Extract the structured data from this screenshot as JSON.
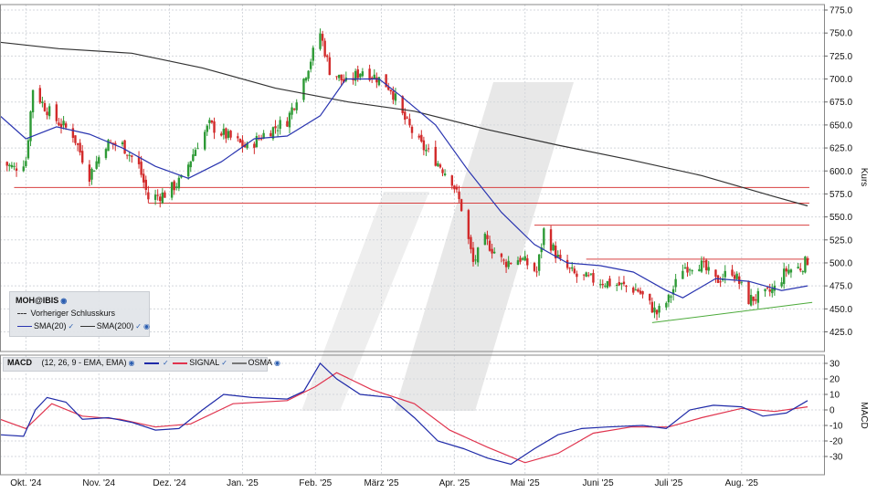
{
  "chart_data": [
    {
      "type": "candlestick",
      "symbol": "MOH@IBIS",
      "ylabel": "Kurs",
      "ylim": [
        425,
        775
      ],
      "yticks": [
        "775.0",
        "750.0",
        "725.0",
        "700.0",
        "675.0",
        "650.0",
        "625.0",
        "600.0",
        "575.0",
        "550.0",
        "525.0",
        "500.0",
        "475.0",
        "450.0",
        "425.0"
      ],
      "xticks": [
        "Okt. '24",
        "Nov. '24",
        "Dez. '24",
        "Jan. '25",
        "Feb. '25",
        "März '25",
        "Apr. '25",
        "Mai '25",
        "Juni '25",
        "Juli '25",
        "Aug. '25"
      ],
      "legend": {
        "symbol": "MOH@IBIS",
        "prev_close": "Vorheriger Schlusskurs",
        "sma20": "SMA(20)",
        "sma200": "SMA(200)"
      },
      "price_path": [
        [
          "2024-09-20",
          610
        ],
        [
          "2024-09-26",
          603
        ],
        [
          "2024-10-01",
          612
        ],
        [
          "2024-10-04",
          690
        ],
        [
          "2024-10-09",
          670
        ],
        [
          "2024-10-14",
          655
        ],
        [
          "2024-10-21",
          640
        ],
        [
          "2024-10-28",
          595
        ],
        [
          "2024-11-04",
          630
        ],
        [
          "2024-11-11",
          628
        ],
        [
          "2024-11-18",
          605
        ],
        [
          "2024-11-22",
          570
        ],
        [
          "2024-11-29",
          575
        ],
        [
          "2024-12-06",
          590
        ],
        [
          "2024-12-13",
          630
        ],
        [
          "2024-12-18",
          650
        ],
        [
          "2024-12-24",
          640
        ],
        [
          "2025-01-03",
          625
        ],
        [
          "2025-01-10",
          640
        ],
        [
          "2025-01-20",
          655
        ],
        [
          "2025-01-27",
          700
        ],
        [
          "2025-02-03",
          750
        ],
        [
          "2025-02-07",
          710
        ],
        [
          "2025-02-14",
          695
        ],
        [
          "2025-02-21",
          710
        ],
        [
          "2025-02-28",
          700
        ],
        [
          "2025-03-05",
          690
        ],
        [
          "2025-03-10",
          660
        ],
        [
          "2025-03-17",
          630
        ],
        [
          "2025-03-24",
          612
        ],
        [
          "2025-03-31",
          590
        ],
        [
          "2025-04-04",
          560
        ],
        [
          "2025-04-09",
          500
        ],
        [
          "2025-04-14",
          525
        ],
        [
          "2025-04-22",
          500
        ],
        [
          "2025-04-29",
          505
        ],
        [
          "2025-05-06",
          490
        ],
        [
          "2025-05-09",
          535
        ],
        [
          "2025-05-16",
          500
        ],
        [
          "2025-05-23",
          485
        ],
        [
          "2025-06-02",
          480
        ],
        [
          "2025-06-10",
          476
        ],
        [
          "2025-06-18",
          470
        ],
        [
          "2025-06-26",
          445
        ],
        [
          "2025-07-01",
          460
        ],
        [
          "2025-07-07",
          495
        ],
        [
          "2025-07-14",
          500
        ],
        [
          "2025-07-21",
          480
        ],
        [
          "2025-07-28",
          492
        ],
        [
          "2025-08-04",
          460
        ],
        [
          "2025-08-11",
          465
        ],
        [
          "2025-08-15",
          472
        ],
        [
          "2025-08-20",
          492
        ],
        [
          "2025-08-26",
          495
        ],
        [
          "2025-08-29",
          503
        ]
      ],
      "sma20_path": [
        [
          "2024-09-20",
          660
        ],
        [
          "2024-10-01",
          635
        ],
        [
          "2024-10-14",
          648
        ],
        [
          "2024-10-28",
          640
        ],
        [
          "2024-11-11",
          625
        ],
        [
          "2024-11-25",
          605
        ],
        [
          "2024-12-09",
          592
        ],
        [
          "2024-12-23",
          610
        ],
        [
          "2025-01-06",
          635
        ],
        [
          "2025-01-20",
          638
        ],
        [
          "2025-02-03",
          660
        ],
        [
          "2025-02-14",
          700
        ],
        [
          "2025-02-28",
          700
        ],
        [
          "2025-03-10",
          680
        ],
        [
          "2025-03-24",
          650
        ],
        [
          "2025-04-07",
          600
        ],
        [
          "2025-04-21",
          555
        ],
        [
          "2025-05-05",
          520
        ],
        [
          "2025-05-19",
          500
        ],
        [
          "2025-06-02",
          497
        ],
        [
          "2025-06-16",
          490
        ],
        [
          "2025-06-30",
          470
        ],
        [
          "2025-07-07",
          462
        ],
        [
          "2025-07-21",
          483
        ],
        [
          "2025-08-04",
          480
        ],
        [
          "2025-08-18",
          470
        ],
        [
          "2025-08-29",
          475
        ]
      ],
      "sma200_path": [
        [
          "2024-09-20",
          740
        ],
        [
          "2024-10-15",
          733
        ],
        [
          "2024-11-15",
          728
        ],
        [
          "2024-12-15",
          712
        ],
        [
          "2025-01-15",
          690
        ],
        [
          "2025-02-15",
          675
        ],
        [
          "2025-03-15",
          665
        ],
        [
          "2025-04-15",
          645
        ],
        [
          "2025-05-15",
          628
        ],
        [
          "2025-06-15",
          612
        ],
        [
          "2025-07-15",
          595
        ],
        [
          "2025-08-15",
          572
        ],
        [
          "2025-08-29",
          562
        ]
      ],
      "horizontal_lines": [
        {
          "from": "2024-09-26",
          "to": "2025-08-29",
          "value": 582,
          "color": "#d84040"
        },
        {
          "from": "2024-11-22",
          "to": "2025-08-29",
          "value": 565,
          "color": "#d84040"
        },
        {
          "from": "2025-05-05",
          "to": "2025-08-29",
          "value": 541,
          "color": "#d84040"
        },
        {
          "from": "2025-05-27",
          "to": "2025-08-29",
          "value": 504,
          "color": "#d84040"
        }
      ],
      "trendline": {
        "from": [
          "2025-06-24",
          435
        ],
        "to": [
          "2025-08-31",
          457
        ],
        "color": "#4caa3a"
      },
      "colors": {
        "up": "#2e9a36",
        "down": "#d22a2a",
        "sma20": "#2a35b0",
        "sma200": "#333333",
        "grid": "#d4d7dc"
      }
    },
    {
      "type": "line",
      "title": "MACD",
      "params": "(12, 26, 9 - EMA, EMA)",
      "ylabel": "MACD",
      "ylim": [
        -35,
        32
      ],
      "yticks": [
        "30",
        "20",
        "10",
        "0",
        "-10",
        "-20",
        "-30"
      ],
      "legend": {
        "macd": "",
        "signal": "SIGNAL",
        "osma": "OSMA"
      },
      "macd_path": [
        [
          "2024-09-20",
          -16
        ],
        [
          "2024-09-30",
          -17
        ],
        [
          "2024-10-05",
          0
        ],
        [
          "2024-10-10",
          8
        ],
        [
          "2024-10-18",
          5
        ],
        [
          "2024-10-25",
          -6
        ],
        [
          "2024-11-05",
          -5
        ],
        [
          "2024-11-15",
          -8
        ],
        [
          "2024-11-25",
          -13
        ],
        [
          "2024-12-05",
          -12
        ],
        [
          "2024-12-15",
          0
        ],
        [
          "2024-12-24",
          10
        ],
        [
          "2025-01-05",
          8
        ],
        [
          "2025-01-20",
          7
        ],
        [
          "2025-01-27",
          12
        ],
        [
          "2025-02-03",
          30
        ],
        [
          "2025-02-10",
          20
        ],
        [
          "2025-02-20",
          10
        ],
        [
          "2025-03-05",
          8
        ],
        [
          "2025-03-15",
          -5
        ],
        [
          "2025-03-25",
          -20
        ],
        [
          "2025-04-05",
          -25
        ],
        [
          "2025-04-15",
          -31
        ],
        [
          "2025-04-25",
          -35
        ],
        [
          "2025-05-05",
          -25
        ],
        [
          "2025-05-15",
          -16
        ],
        [
          "2025-05-25",
          -12
        ],
        [
          "2025-06-05",
          -11
        ],
        [
          "2025-06-20",
          -10
        ],
        [
          "2025-06-30",
          -12
        ],
        [
          "2025-07-10",
          0
        ],
        [
          "2025-07-20",
          3
        ],
        [
          "2025-08-01",
          2
        ],
        [
          "2025-08-10",
          -4
        ],
        [
          "2025-08-20",
          -2
        ],
        [
          "2025-08-29",
          6
        ]
      ],
      "signal_path": [
        [
          "2024-09-20",
          -6
        ],
        [
          "2024-10-01",
          -12
        ],
        [
          "2024-10-12",
          4
        ],
        [
          "2024-10-25",
          -4
        ],
        [
          "2024-11-10",
          -6
        ],
        [
          "2024-11-25",
          -11
        ],
        [
          "2024-12-10",
          -9
        ],
        [
          "2024-12-28",
          4
        ],
        [
          "2025-01-20",
          6
        ],
        [
          "2025-02-01",
          15
        ],
        [
          "2025-02-10",
          24
        ],
        [
          "2025-02-25",
          13
        ],
        [
          "2025-03-15",
          4
        ],
        [
          "2025-03-30",
          -13
        ],
        [
          "2025-04-15",
          -24
        ],
        [
          "2025-05-01",
          -34
        ],
        [
          "2025-05-15",
          -28
        ],
        [
          "2025-05-30",
          -15
        ],
        [
          "2025-06-15",
          -11
        ],
        [
          "2025-07-01",
          -11
        ],
        [
          "2025-07-15",
          -5
        ],
        [
          "2025-08-01",
          1
        ],
        [
          "2025-08-15",
          -1
        ],
        [
          "2025-08-29",
          2
        ]
      ],
      "colors": {
        "macd": "#1f2aa8",
        "signal": "#e0344e",
        "osma": "#777777"
      }
    }
  ]
}
